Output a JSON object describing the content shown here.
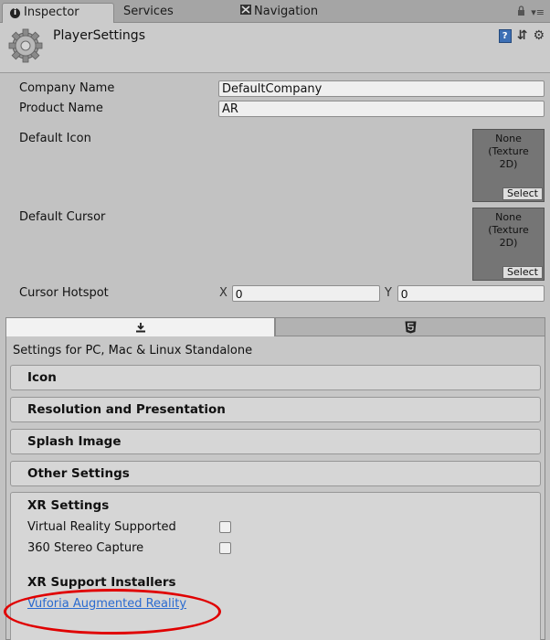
{
  "tabs": {
    "inspector": "Inspector",
    "services": "Services",
    "navigation": "Navigation"
  },
  "header": {
    "title": "PlayerSettings"
  },
  "fields": {
    "company_label": "Company Name",
    "company_value": "DefaultCompany",
    "product_label": "Product Name",
    "product_value": "AR",
    "default_icon_label": "Default Icon",
    "default_cursor_label": "Default Cursor",
    "texture_none": "None\n(Texture\n2D)",
    "texture_select": "Select",
    "hotspot_label": "Cursor Hotspot",
    "hotspot_x_label": "X",
    "hotspot_x_value": "0",
    "hotspot_y_label": "Y",
    "hotspot_y_value": "0"
  },
  "platform": {
    "caption": "Settings for PC, Mac & Linux Standalone",
    "sections": [
      "Icon",
      "Resolution and Presentation",
      "Splash Image",
      "Other Settings"
    ],
    "xr": {
      "title": "XR Settings",
      "vr_supported": "Virtual Reality Supported",
      "stereo_capture": "360 Stereo Capture",
      "installers_title": "XR Support Installers",
      "vuforia_link": "Vuforia Augmented Reality"
    }
  },
  "colors": {
    "annotation": "#e00000",
    "link": "#2a6bd0"
  }
}
